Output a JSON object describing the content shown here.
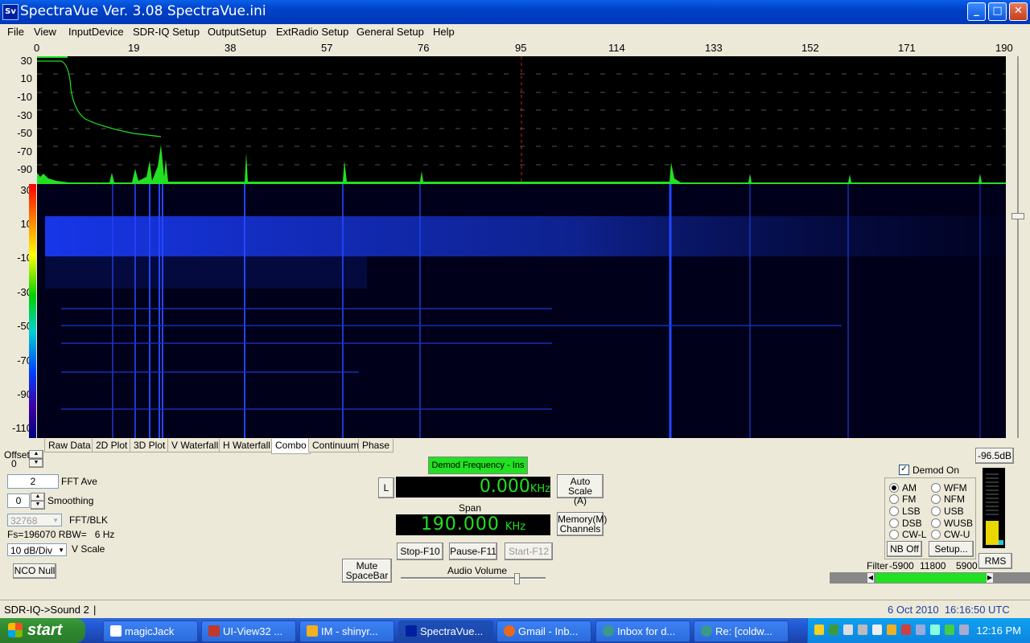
{
  "window": {
    "icon_text": "Sv",
    "title": "SpectraVue Ver. 3.08 SpectraVue.ini",
    "min": "_",
    "max": "□",
    "close": "✕"
  },
  "menu": [
    "File",
    "View",
    "InputDevice",
    "SDR-IQ Setup",
    "OutputSetup",
    "ExtRadio Setup",
    "General Setup",
    "Help"
  ],
  "x_ticks": [
    "0",
    "19",
    "38",
    "57",
    "76",
    "95",
    "114",
    "133",
    "152",
    "171",
    "190"
  ],
  "spectrum_y_ticks": [
    "30",
    "10",
    "-10",
    "-30",
    "-50",
    "-70",
    "-90"
  ],
  "waterfall_y_ticks": [
    "30",
    "10",
    "-10",
    "-30",
    "-50",
    "-70",
    "-90",
    "-110"
  ],
  "tabs": [
    "Raw Data",
    "2D Plot",
    "3D Plot",
    "V Waterfall",
    "H Waterfall",
    "Combo",
    "Continuum",
    "Phase"
  ],
  "active_tab": "Combo",
  "left_controls": {
    "offset_label": "Offset",
    "offset_value": "0",
    "fft_ave_value": "2",
    "fft_ave_label": "FFT Ave",
    "smoothing_value": "0",
    "smoothing_label": "Smoothing",
    "fft_blk_value": "32768",
    "fft_blk_label": "FFT/BLK",
    "fs_rbw": "Fs=196070 RBW=   6 Hz",
    "vscale_value": "10 dB/Div",
    "vscale_label": "V Scale",
    "nco_null": "NCO Null"
  },
  "center_controls": {
    "demod_freq_btn": "Demod Frequency - Ins",
    "l_btn": "L",
    "freq_value": "0.000",
    "freq_unit": "KHz",
    "auto_scale": "Auto Scale",
    "auto_scale_sub": "(A)",
    "span_label": "Span",
    "span_value": "190.000",
    "span_unit": "KHz",
    "memory": "Memory(M)",
    "memory_sub": "Channels",
    "mute": "Mute",
    "mute_sub": "SpaceBar",
    "stop": "Stop-F10",
    "pause": "Pause-F11",
    "start": "Start-F12",
    "audio_volume": "Audio Volume",
    "audio_volume_level": 0.8
  },
  "right_controls": {
    "demod_on_label": "Demod On",
    "demod_on": true,
    "modes": [
      "AM",
      "WFM",
      "FM",
      "NFM",
      "LSB",
      "USB",
      "DSB",
      "WUSB",
      "CW-L",
      "CW-U"
    ],
    "selected_mode": "AM",
    "nb_off": "NB Off",
    "setup": "Setup...",
    "level_db": "-96.5dB",
    "rms": "RMS",
    "filter_label": "Filter",
    "filter_low": "-5900",
    "filter_width": "11800",
    "filter_high": "5900"
  },
  "status": {
    "left": "SDR-IQ->Sound 2",
    "right": "6 Oct 2010  16:16:50 UTC"
  },
  "taskbar": {
    "start": "start",
    "tasks": [
      "magicJack",
      "UI-View32 ...",
      "IM - shinyr...",
      "SpectraVue...",
      "Gmail - Inb...",
      "Inbox for d...",
      "Re: [coldw..."
    ],
    "active_task": "SpectraVue...",
    "clock": "12:16 PM"
  },
  "colors": {
    "plot_bg": "#000000",
    "trace": "#22e022",
    "waterfall_signal": "#1a3cff",
    "center_marker": "#d02020"
  }
}
